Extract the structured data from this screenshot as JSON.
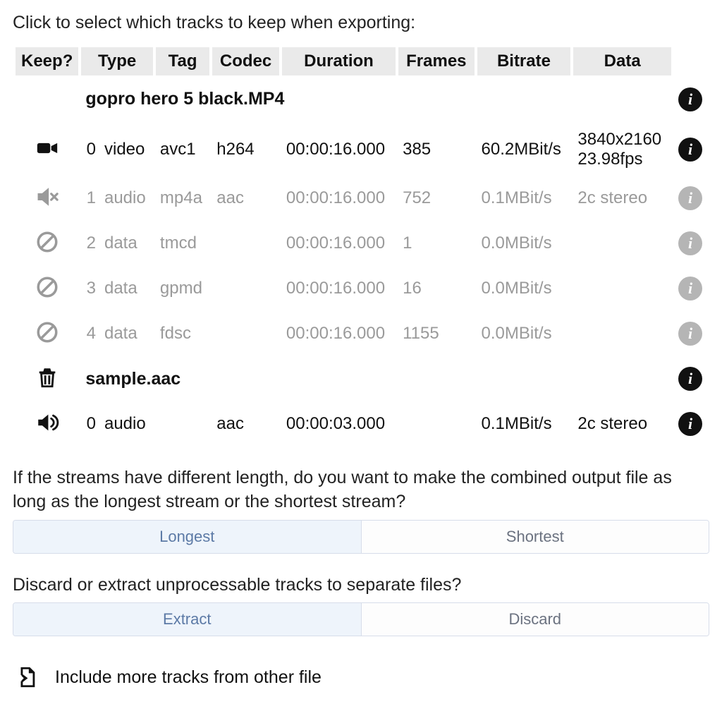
{
  "heading": "Click to select which tracks to keep when exporting:",
  "columns": {
    "keep": "Keep?",
    "type": "Type",
    "tag": "Tag",
    "codec": "Codec",
    "duration": "Duration",
    "frames": "Frames",
    "bitrate": "Bitrate",
    "data": "Data"
  },
  "files": [
    {
      "name": "gopro hero 5 black.MP4",
      "delete_icon": "",
      "tracks": [
        {
          "icon": "video-on",
          "muted": false,
          "idx": "0",
          "type": "video",
          "tag": "avc1",
          "codec": "h264",
          "duration": "00:00:16.000",
          "frames": "385",
          "bitrate": "60.2MBit/s",
          "data": "3840x2160 23.98fps"
        },
        {
          "icon": "audio-mute",
          "muted": true,
          "idx": "1",
          "type": "audio",
          "tag": "mp4a",
          "codec": "aac",
          "duration": "00:00:16.000",
          "frames": "752",
          "bitrate": "0.1MBit/s",
          "data": "2c stereo"
        },
        {
          "icon": "ban",
          "muted": true,
          "idx": "2",
          "type": "data",
          "tag": "tmcd",
          "codec": "",
          "duration": "00:00:16.000",
          "frames": "1",
          "bitrate": "0.0MBit/s",
          "data": ""
        },
        {
          "icon": "ban",
          "muted": true,
          "idx": "3",
          "type": "data",
          "tag": "gpmd",
          "codec": "",
          "duration": "00:00:16.000",
          "frames": "16",
          "bitrate": "0.0MBit/s",
          "data": ""
        },
        {
          "icon": "ban",
          "muted": true,
          "idx": "4",
          "type": "data",
          "tag": "fdsc",
          "codec": "",
          "duration": "00:00:16.000",
          "frames": "1155",
          "bitrate": "0.0MBit/s",
          "data": ""
        }
      ]
    },
    {
      "name": "sample.aac",
      "delete_icon": "trash",
      "tracks": [
        {
          "icon": "audio-on",
          "muted": false,
          "idx": "0",
          "type": "audio",
          "tag": "",
          "codec": "aac",
          "duration": "00:00:03.000",
          "frames": "",
          "bitrate": "0.1MBit/s",
          "data": "2c stereo"
        }
      ]
    }
  ],
  "length_question": "If the streams have different length, do you want to make the combined output file as long as the longest stream or the shortest stream?",
  "length_options": {
    "longest": "Longest",
    "shortest": "Shortest",
    "selected": "longest"
  },
  "discard_question": "Discard or extract unprocessable tracks to separate files?",
  "discard_options": {
    "extract": "Extract",
    "discard": "Discard",
    "selected": "extract"
  },
  "include_more": "Include more tracks from other file"
}
